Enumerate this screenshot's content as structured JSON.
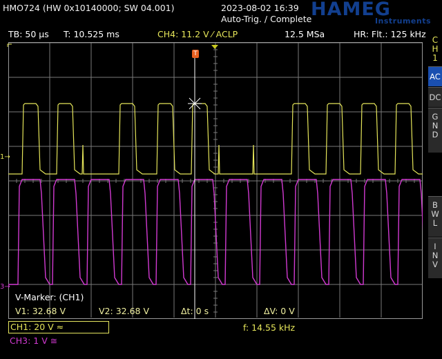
{
  "header": {
    "device": "HMO724 (HW 0x10140000; SW 04.001)",
    "datetime": "2023-08-02 16:39",
    "trigger_status": "Auto-Trig. / Complete",
    "logo": "HAMEG",
    "logo_sub": "Instruments"
  },
  "info_bar": {
    "timebase": "TB: 50 µs",
    "trigger_time": "T: 10.525 ms",
    "trigger_info": "CH4: 11.2 V ⁄ ACLP",
    "sample_rate": "12.5 MSa",
    "filter": "HR: Flt.: 125 kHz"
  },
  "side_menu": {
    "channel_label": [
      "C",
      "H",
      "1"
    ],
    "items": [
      {
        "label": [
          "AC"
        ],
        "active": true
      },
      {
        "label": [
          "DC"
        ],
        "active": false
      },
      {
        "label": [
          "G",
          "N",
          "D"
        ],
        "active": false
      },
      {
        "label": [
          "B",
          "W",
          "L"
        ],
        "active": false
      },
      {
        "label": [
          "I",
          "N",
          "V"
        ],
        "active": false
      }
    ]
  },
  "markers": {
    "ch1_marker": "1",
    "ch3_marker": "3",
    "trigger_marker": "T"
  },
  "v_marker": {
    "title": "V-Marker: (CH1)",
    "v1": "V1: 32.68 V",
    "v2": "V2: 32.68 V",
    "dt": "Δt: 0 s",
    "dv": "ΔV: 0 V"
  },
  "channels": {
    "ch1": "CH1: 20 V ≈",
    "freq": "f: 14.55 kHz",
    "ch3": "CH3: 1 V ≅"
  },
  "colors": {
    "ch1": "#e6e65a",
    "ch3": "#d23ad2",
    "trigger": "#d0d040",
    "grid": "#7a7a7a"
  }
}
